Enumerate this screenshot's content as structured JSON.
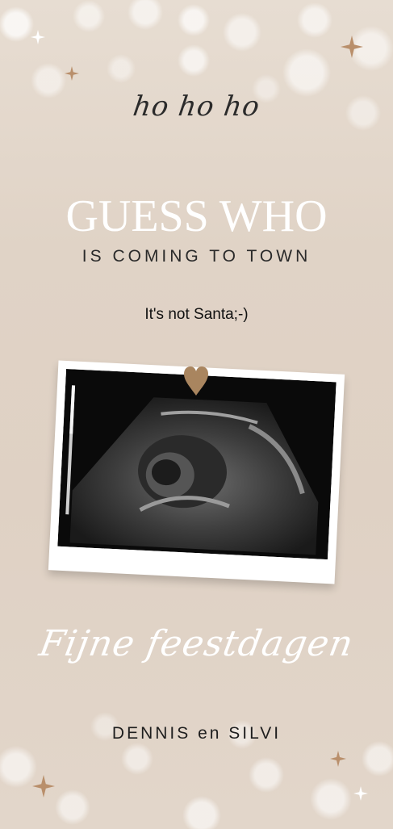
{
  "greeting_script": "ho ho ho",
  "headline": "GUESS WHO",
  "subheadline": "IS COMING TO TOWN",
  "tagline": "It's not Santa;-)",
  "wish_script": "Fijne feestdagen",
  "signature": "DENNIS en SILVI",
  "colors": {
    "background": "#e0d3c6",
    "gold_sparkle": "#b98f6b",
    "heart": "#a9855f",
    "headline": "#ffffff"
  },
  "icons": [
    "sparkle-icon",
    "heart-icon"
  ]
}
